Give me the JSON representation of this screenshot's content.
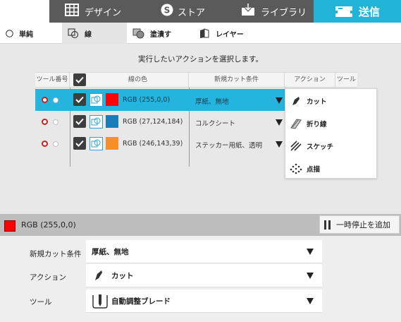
{
  "nav": {
    "tabs": [
      {
        "label": "デザイン",
        "icon": "grid-icon"
      },
      {
        "label": "ストア",
        "icon": "store-s-icon"
      },
      {
        "label": "ライブラリ",
        "icon": "library-download-icon"
      },
      {
        "label": "送信",
        "icon": "cutter-send-icon",
        "active": true
      }
    ]
  },
  "subtabs": [
    {
      "label": "単純",
      "icon": "radio-icon"
    },
    {
      "label": "線",
      "icon": "line-icon",
      "active": true
    },
    {
      "label": "塗潰す",
      "icon": "fill-icon"
    },
    {
      "label": "レイヤー",
      "icon": "layer-icon"
    }
  ],
  "instruction": "実行したいアクションを選択します。",
  "table": {
    "headers": {
      "tool_no": "ツール番号",
      "line_color": "線の色",
      "cut_condition": "新規カット条件",
      "action": "アクション",
      "tool": "ツール"
    },
    "rows": [
      {
        "rgb": "RGB (255,0,0)",
        "color": "#ff0000",
        "condition": "厚紙、無地",
        "selected": true
      },
      {
        "rgb": "RGB (27,124,184)",
        "color": "#1b7cb8",
        "condition": "コルクシート"
      },
      {
        "rgb": "RGB (246,143,39)",
        "color": "#f68f27",
        "condition": "ステッカー用紙、透明"
      }
    ]
  },
  "action_menu": [
    {
      "label": "カット",
      "icon": "knife-icon"
    },
    {
      "label": "折り線",
      "icon": "fold-icon"
    },
    {
      "label": "スケッチ",
      "icon": "sketch-icon"
    },
    {
      "label": "点描",
      "icon": "dots-icon"
    }
  ],
  "selection": {
    "rgb": "RGB (255,0,0)",
    "color": "#ff0000",
    "pause_button": "一時停止を追加"
  },
  "properties": {
    "cut_condition_label": "新規カット条件",
    "cut_condition_value": "厚紙、無地",
    "action_label": "アクション",
    "action_value": "カット",
    "tool_label": "ツール",
    "tool_value": "自動調整ブレード"
  },
  "colors": {
    "accent": "#22b3d8",
    "nav_dark": "#5a5a5a"
  }
}
